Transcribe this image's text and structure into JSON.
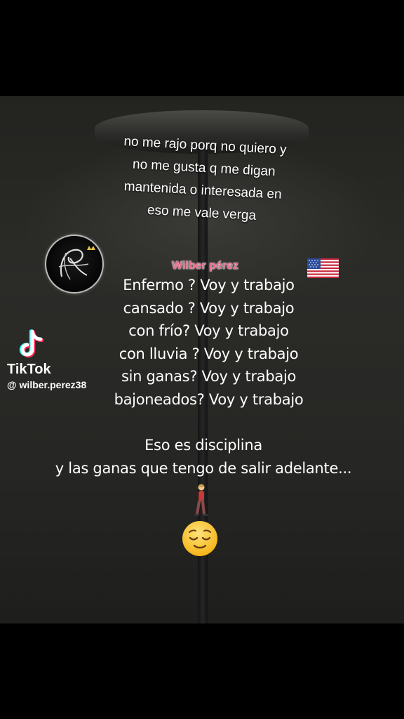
{
  "caption": {
    "lines": [
      "no me rajo porq no quiero y",
      "no me gusta q me digan",
      "mantenida o interesada en",
      "eso me vale verga"
    ]
  },
  "watermark": {
    "name": "Wilber pérez",
    "name_color": "#e86c8c"
  },
  "icons": {
    "flag": "us-flag-icon",
    "logo": "monogram-logo-icon",
    "tiktok": "tiktok-logo-icon",
    "walker": "person-walking-icon",
    "face": "relieved-face-icon"
  },
  "main": {
    "lines": [
      "Enfermo ? Voy y trabajo",
      "cansado ? Voy y trabajo",
      "con frío? Voy y trabajo",
      "con lluvia ? Voy y trabajo",
      "sin ganas? Voy y trabajo",
      "bajoneados? Voy y trabajo"
    ]
  },
  "closing": {
    "lines": [
      "Eso es disciplina",
      "y las ganas que tengo de salir adelante..."
    ]
  },
  "tiktok": {
    "brand": "TikTok",
    "username": "@ wilber.perez38"
  }
}
